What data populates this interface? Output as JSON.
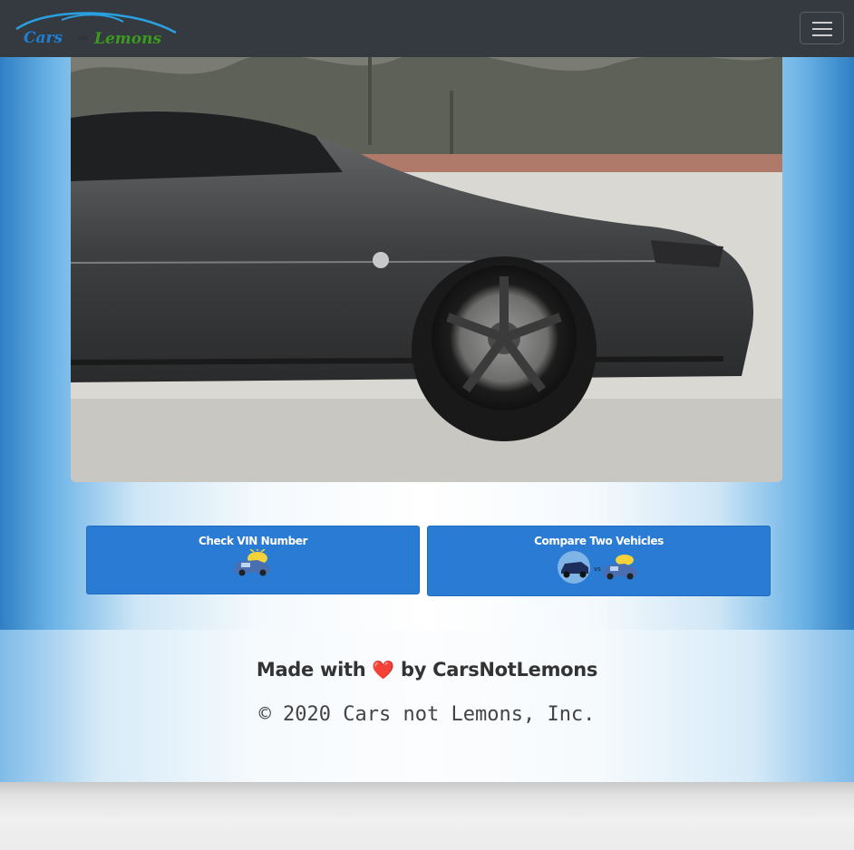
{
  "navbar": {
    "brand_logo": {
      "word1": "Cars",
      "word2": "not",
      "word3": "Lemons",
      "colors": {
        "cars": "#1f7fd1",
        "not": "#2b2b2b",
        "lemons": "#3c9a1e",
        "swoosh": "#2aa0e0"
      }
    },
    "menu_icon": "hamburger-icon"
  },
  "hero": {
    "image": "gray-mustang-side-photo"
  },
  "actions": [
    {
      "label": "Check VIN Number",
      "icon": "car-with-lemon-icon"
    },
    {
      "label": "Compare Two Vehicles",
      "icon": "two-cars-compare-icon"
    }
  ],
  "footer": {
    "made_with": "Made with",
    "heart_icon": "heart-icon",
    "heart": "❤️",
    "by": "by CarsNotLemons",
    "copyright": "© 2020 Cars not Lemons, Inc."
  },
  "colors": {
    "navbar_bg": "#343a40",
    "action_blue": "#2a7bd4",
    "background_blue": "#2f7fc4"
  }
}
